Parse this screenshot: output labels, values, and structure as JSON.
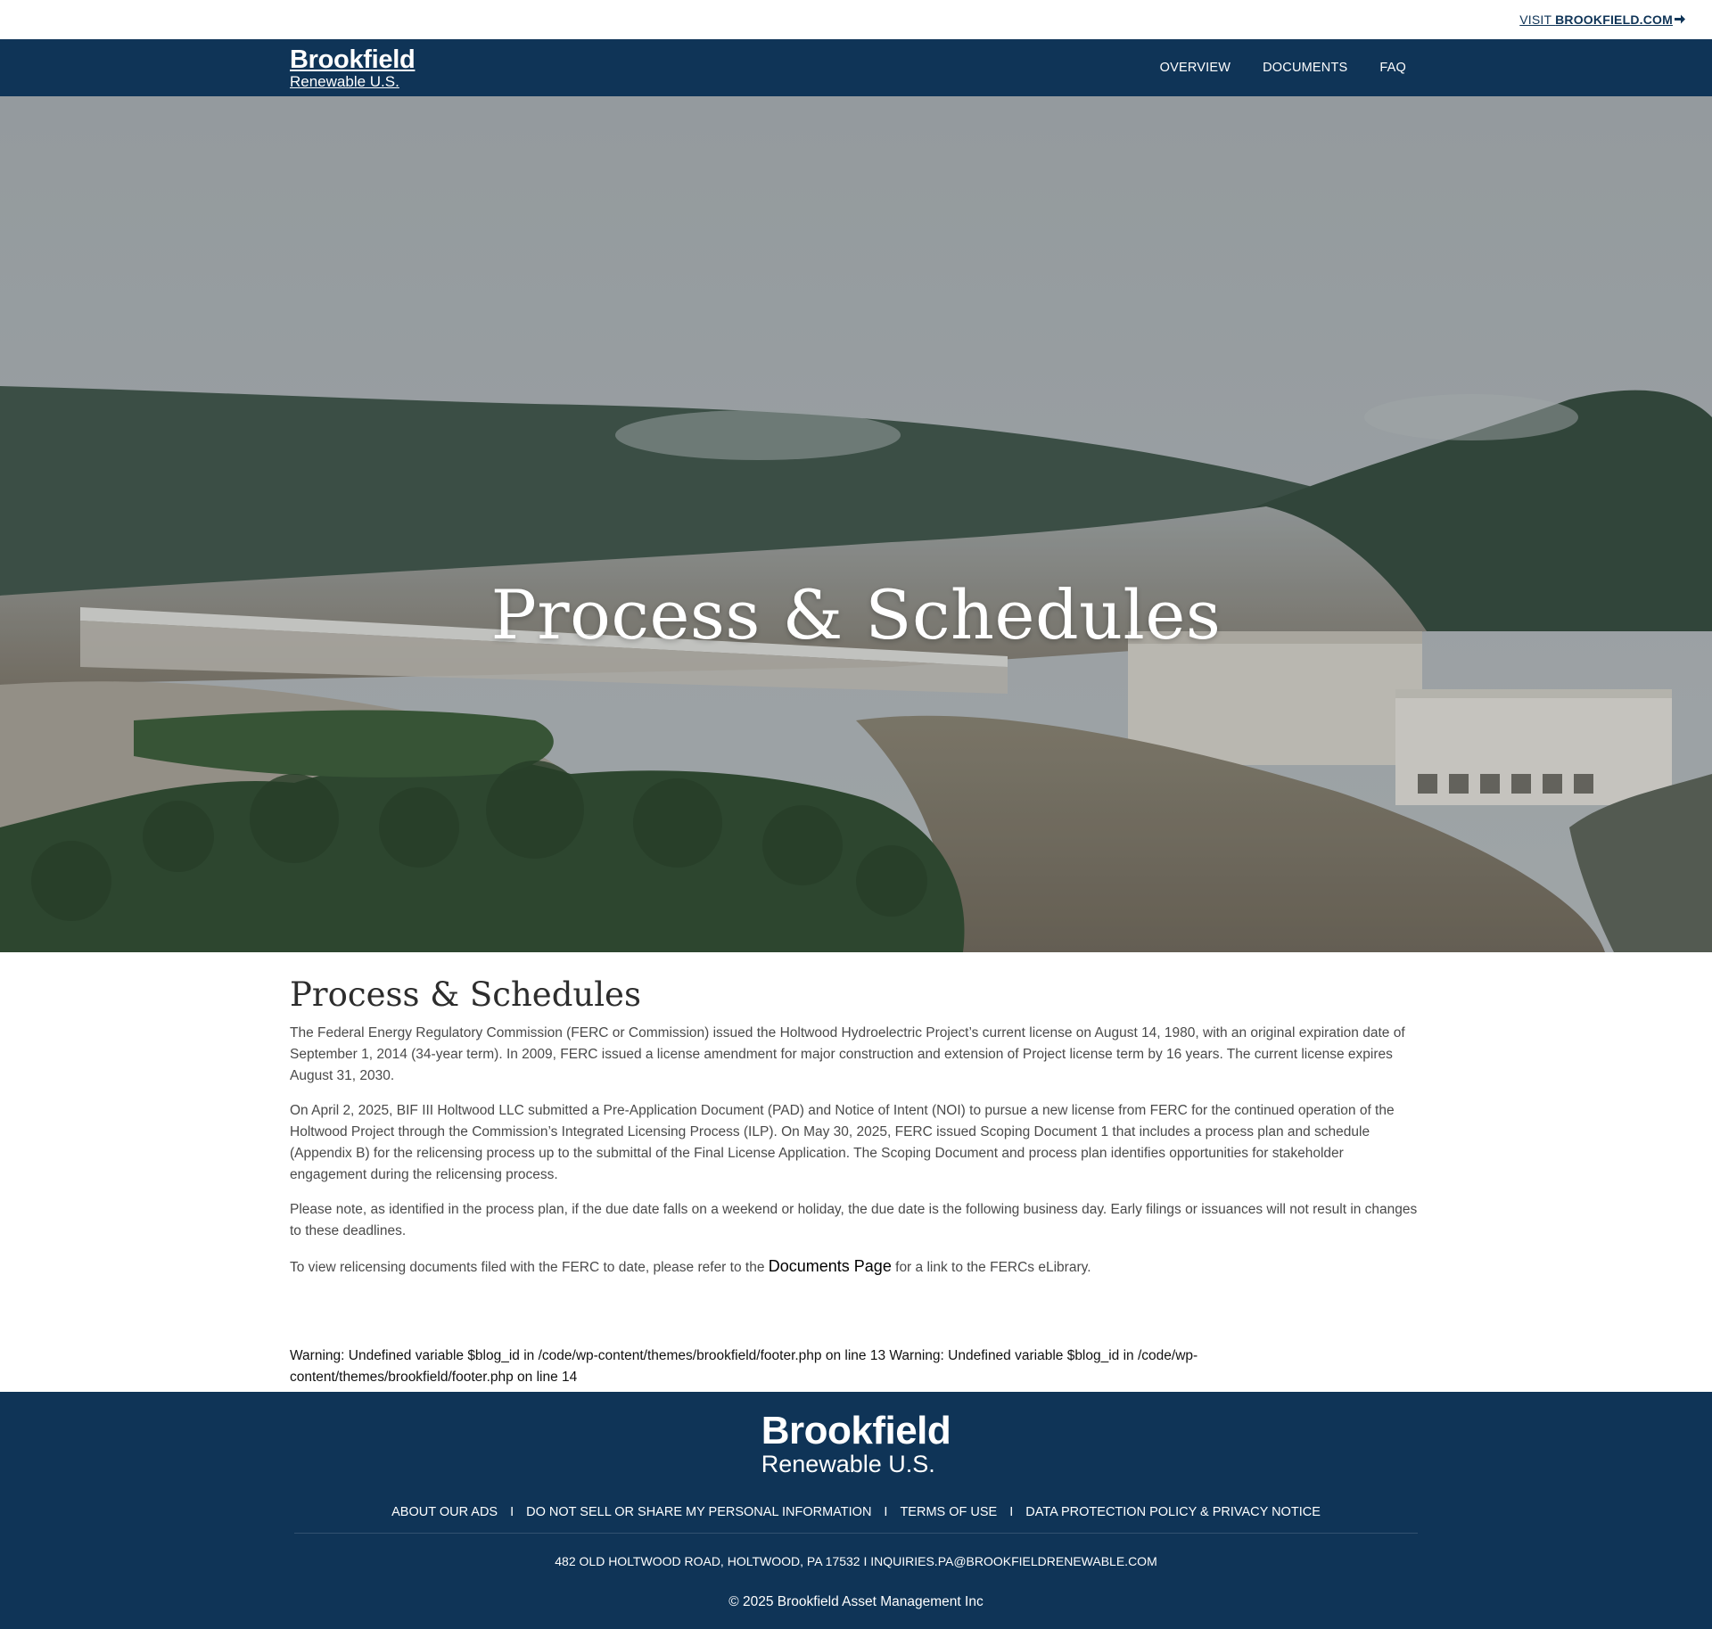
{
  "utility": {
    "visit_prefix": "VISIT ",
    "visit_site": "BROOKFIELD.COM",
    "arrow_icon": "arrow-right-icon"
  },
  "header": {
    "logo_line1": "Brookfield",
    "logo_line2": "Renewable U.S.",
    "nav": [
      "OVERVIEW",
      "DOCUMENTS",
      "FAQ"
    ]
  },
  "hero": {
    "title": "Process & Schedules"
  },
  "main": {
    "heading": "Process & Schedules",
    "p1": "The Federal Energy Regulatory Commission (FERC or Commission) issued the Holtwood Hydroelectric Project’s current license on August 14, 1980, with an original expiration date of September 1, 2014 (34-year term). In 2009, FERC issued a license amendment for major construction and extension of Project license term by 16 years. The current license expires August 31, 2030.",
    "p2": "On April 2, 2025, BIF III Holtwood LLC submitted a Pre-Application Document (PAD) and Notice of Intent (NOI) to pursue a new license from FERC for the continued operation of the Holtwood Project through the Commission’s Integrated Licensing Process (ILP). On May 30, 2025, FERC issued Scoping Document 1 that includes a process plan and schedule (Appendix B) for the relicensing process up to the submittal of the Final License Application. The Scoping Document and process plan identifies opportunities for stakeholder engagement during the relicensing process.",
    "p3": "Please note, as identified in the process plan, if the due date falls on a weekend or holiday, the due date is the following business day. Early filings or issuances will not result in changes to these deadlines.",
    "p4_before": "To view relicensing documents filed with the FERC to date, please refer to the ",
    "p4_link": "Documents Page",
    "p4_after": " for a link to the FERCs eLibrary."
  },
  "warning": "Warning: Undefined variable $blog_id in /code/wp-content/themes/brookfield/footer.php on line 13 Warning: Undefined variable $blog_id in /code/wp-content/themes/brookfield/footer.php on line 14",
  "footer": {
    "logo_line1": "Brookfield",
    "logo_line2": "Renewable U.S.",
    "links": [
      "ABOUT OUR ADS",
      "DO NOT SELL OR SHARE MY PERSONAL INFORMATION",
      "TERMS OF USE",
      "DATA PROTECTION POLICY & PRIVACY NOTICE"
    ],
    "separator": "I",
    "address": "482 OLD HOLTWOOD ROAD, HOLTWOOD, PA 17532 I INQUIRIES.PA@BROOKFIELDRENEWABLE.COM",
    "copyright": "© 2025 Brookfield Asset Management Inc"
  },
  "colors": {
    "brand_navy": "#0f3457",
    "text_gray": "#4a4a4a"
  }
}
